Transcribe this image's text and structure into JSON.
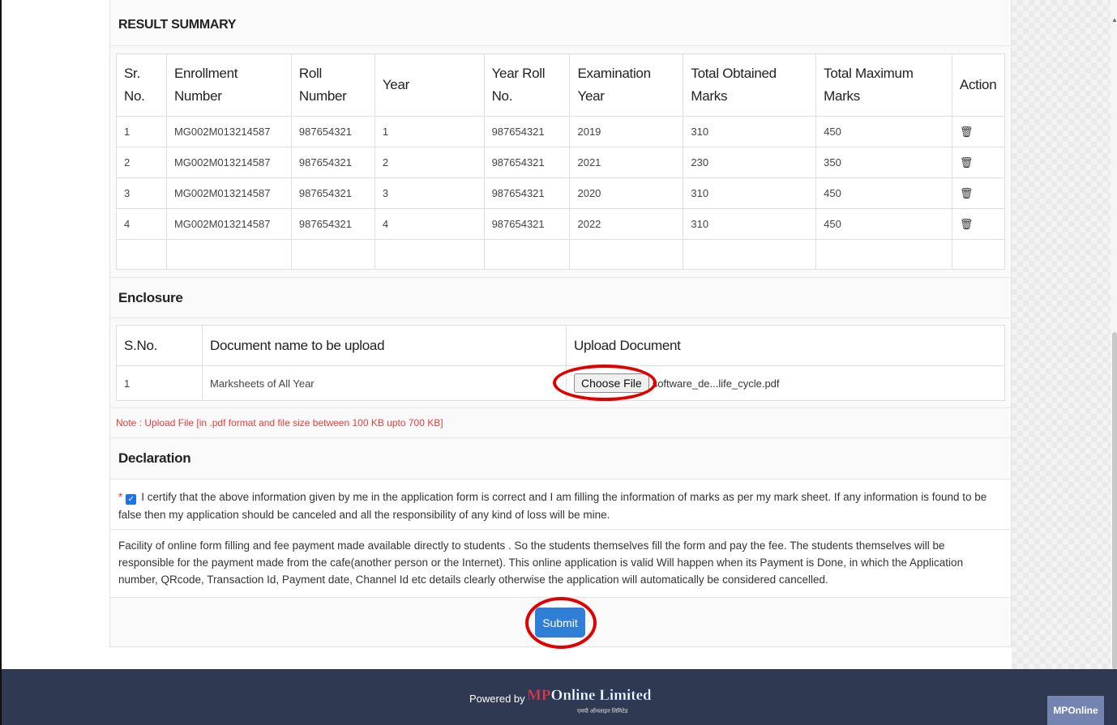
{
  "result_summary": {
    "title": "RESULT SUMMARY",
    "headers": [
      "Sr. No.",
      "Enrollment Number",
      "Roll Number",
      "Year",
      "Year Roll No.",
      "Examination Year",
      "Total Obtained Marks",
      "Total Maximum Marks",
      "Action"
    ],
    "rows": [
      [
        "1",
        "MG002M013214587",
        "987654321",
        "1",
        "987654321",
        "2019",
        "310",
        "450"
      ],
      [
        "2",
        "MG002M013214587",
        "987654321",
        "2",
        "987654321",
        "2021",
        "230",
        "350"
      ],
      [
        "3",
        "MG002M013214587",
        "987654321",
        "3",
        "987654321",
        "2020",
        "310",
        "450"
      ],
      [
        "4",
        "MG002M013214587",
        "987654321",
        "4",
        "987654321",
        "2022",
        "310",
        "450"
      ]
    ],
    "action_icon": "trash-icon"
  },
  "enclosure": {
    "title": "Enclosure",
    "headers": [
      "S.No.",
      "Document name to be upload",
      "Upload Document"
    ],
    "rows": [
      {
        "sno": "1",
        "document": "Marksheets of All Year",
        "button_label": "Choose File",
        "file_name": "software_de...life_cycle.pdf"
      }
    ],
    "note": "Note : Upload File [in .pdf format and file size between 100 KB upto 700 KB]"
  },
  "declaration": {
    "title": "Declaration",
    "required_mark": "*",
    "checked": true,
    "text": "I certify that the above information given by me in the application form is correct and I am filling the information of marks as per my mark sheet. If any information is found to be false then my application should be canceled and all the responsibility of any kind of loss will be mine.",
    "facility_text": "Facility of online form filling and fee payment made available directly to students . So the students themselves fill the form and pay the fee. The students themselves will be responsible for the payment made from the cafe(another person or the Internet). This online application is valid Will happen when its Payment is Done, in which the Application number, QRcode, Transaction Id, Payment date, Channel Id etc details clearly otherwise the application will automatically be considered cancelled."
  },
  "submit_label": "Submit",
  "footer": {
    "powered_by": "Powered by",
    "logo_text_mp": "MP",
    "logo_text_rest": "Online Limited",
    "logo_sub": "एमपी ऑनलाइन लिमिटेड",
    "badge": "MPOnline"
  },
  "colors": {
    "accent": "#2f7fd6",
    "note_red": "#e23d3d",
    "footer_bg": "#2f3a52",
    "highlight_ring": "#e00000"
  }
}
